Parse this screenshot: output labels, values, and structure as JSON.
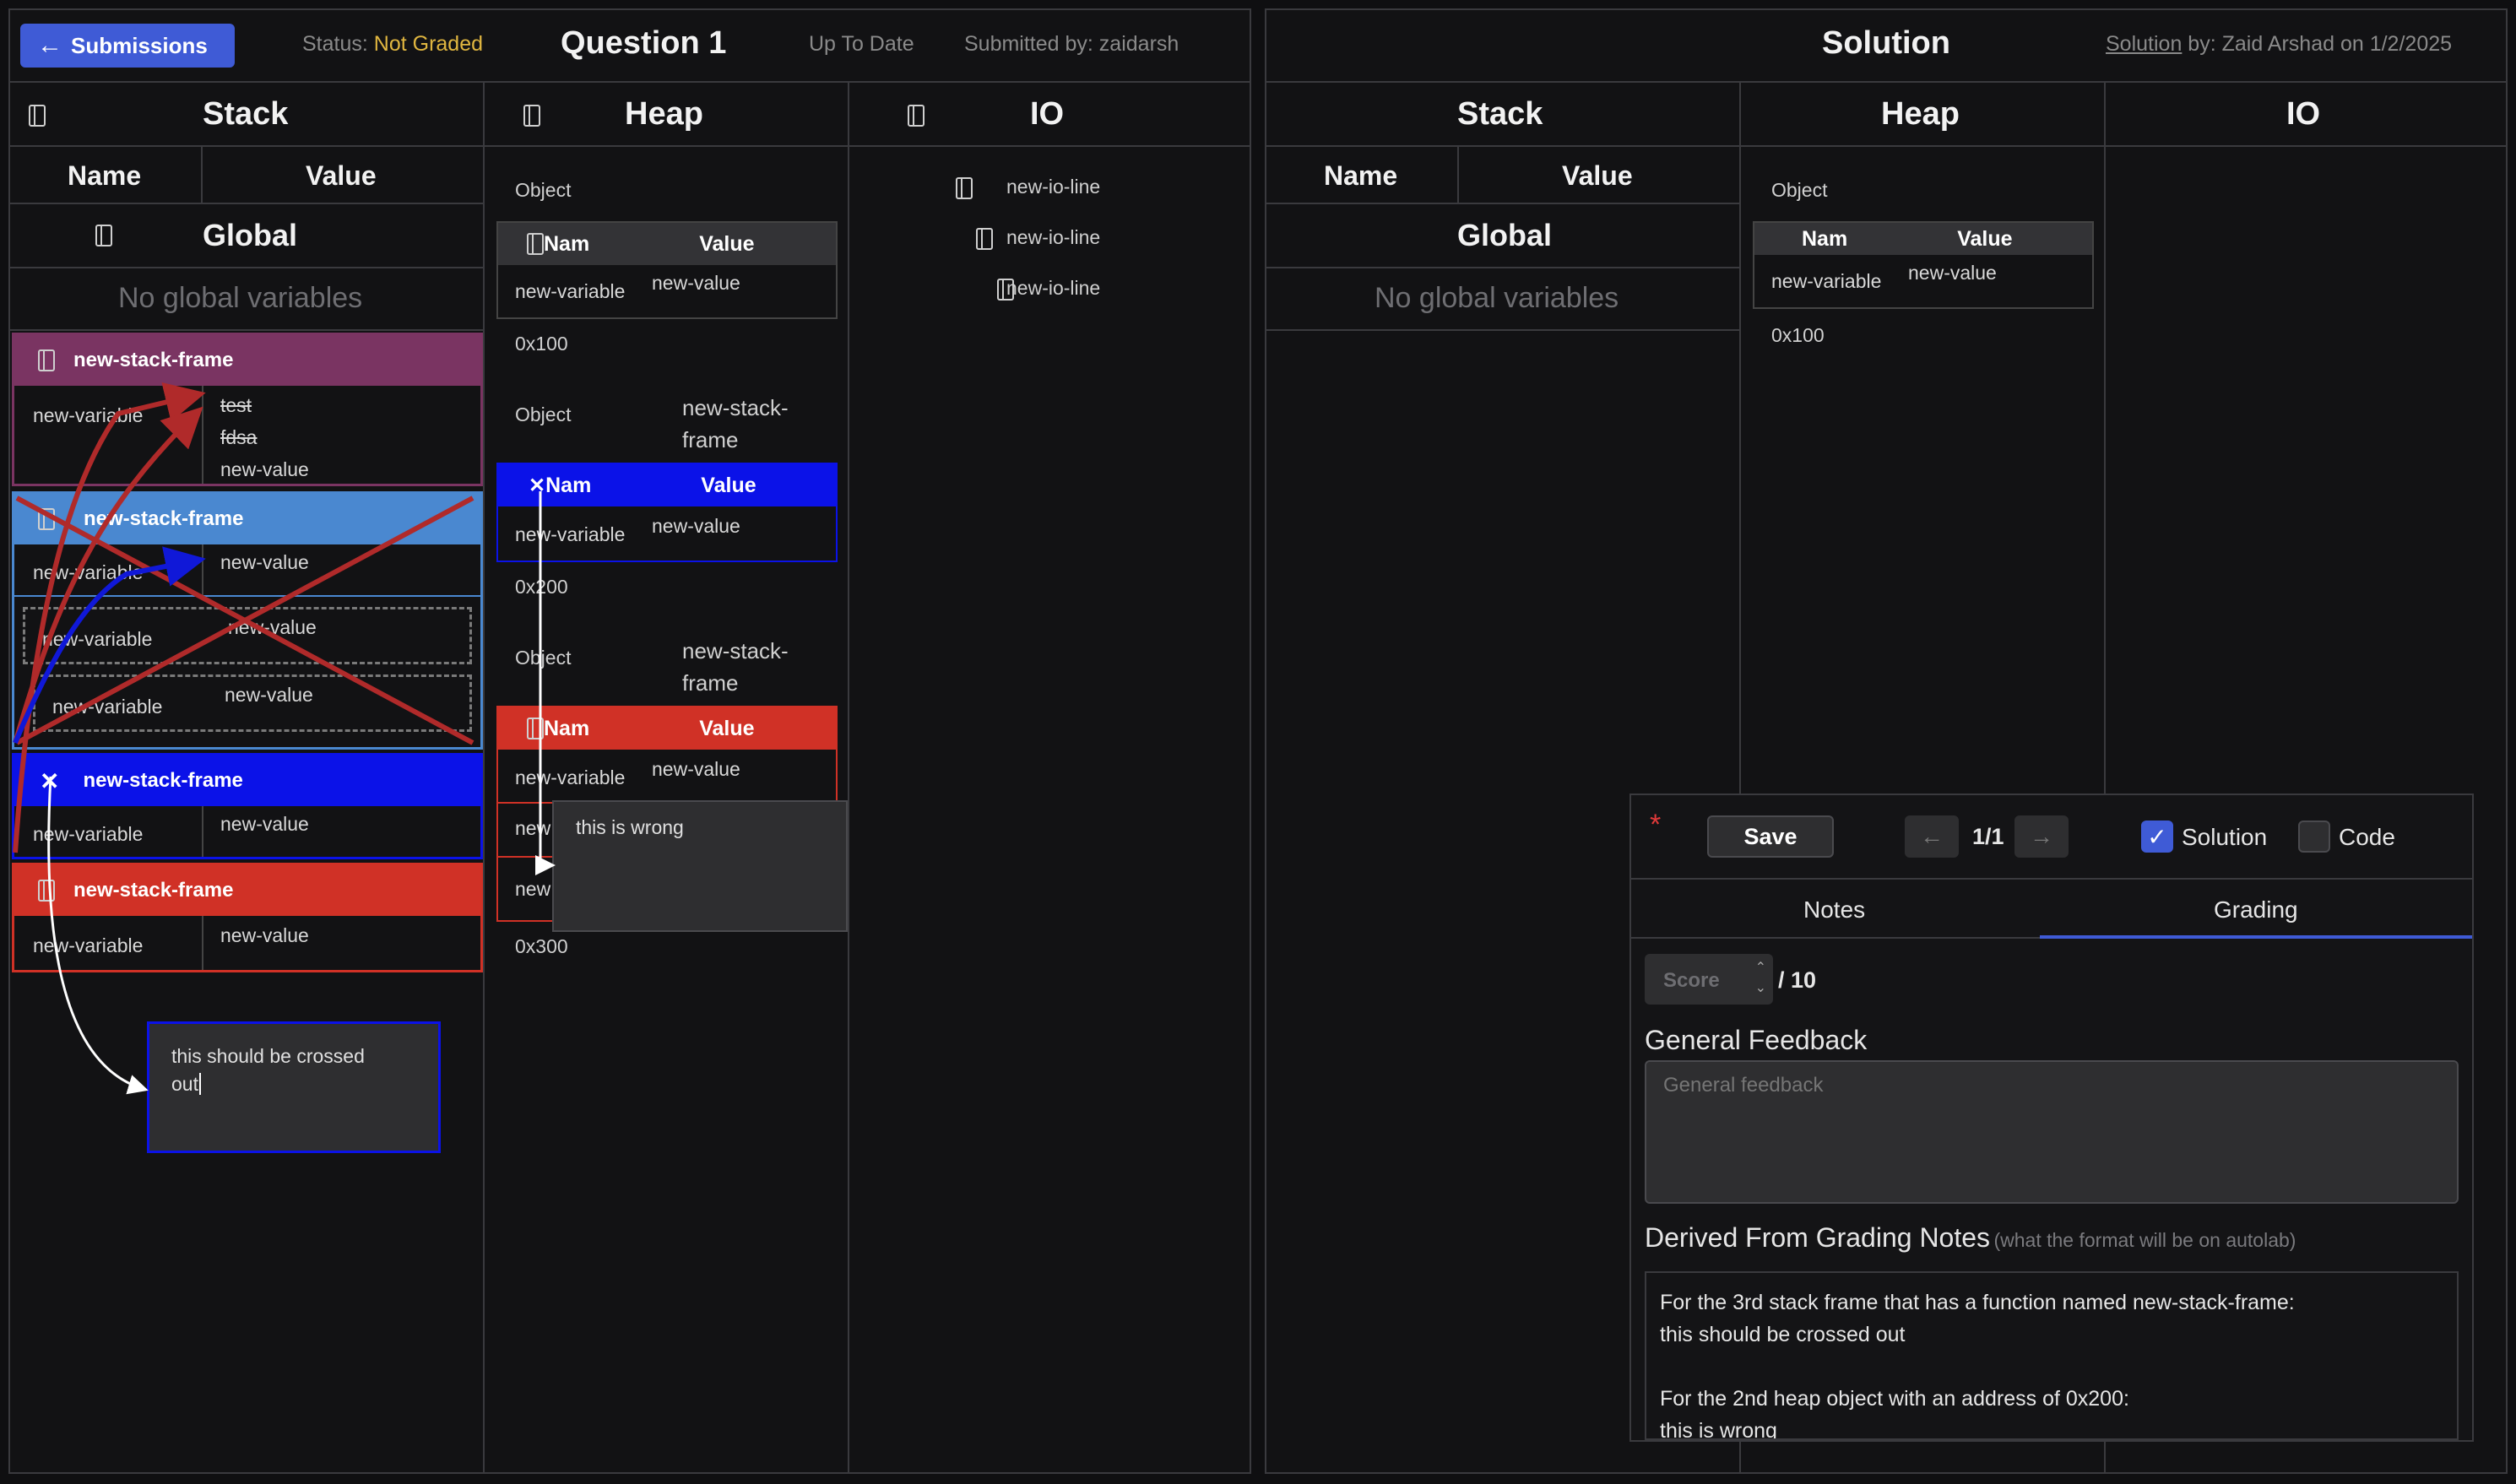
{
  "header": {
    "submissions_label": "Submissions",
    "status_label": "Status:",
    "status_value": "Not Graded",
    "question_title": "Question 1",
    "up_to_date": "Up To Date",
    "submitted_by": "Submitted by: zaidarsh",
    "solution_title": "Solution",
    "solution_link": "Solution",
    "solution_by": " by: Zaid Arshad on 1/2/2025"
  },
  "columns": {
    "stack": "Stack",
    "heap": "Heap",
    "io": "IO",
    "name": "Name",
    "value": "Value",
    "global": "Global",
    "no_globals": "No global variables"
  },
  "stack_frames": [
    {
      "title": "new-stack-frame",
      "var": "new-variable",
      "values": [
        "test",
        "fdsa",
        "new-value"
      ]
    },
    {
      "title": "new-stack-frame",
      "var": "new-variable",
      "value": "new-value",
      "nested1_var": "new-variable",
      "nested1_val": "new-value",
      "nested2_var": "new-variable",
      "nested2_val": "new-value"
    },
    {
      "title": "new-stack-frame",
      "var": "new-variable",
      "value": "new-value"
    },
    {
      "title": "new-stack-frame",
      "var": "new-variable",
      "value": "new-value"
    }
  ],
  "heap": {
    "objects": [
      {
        "label": "Object",
        "name_h": "Nam",
        "value_h": "Value",
        "var": "new-variable",
        "val": "new-value",
        "addr": "0x100"
      },
      {
        "label": "Object",
        "frame_line1": "new-stack-",
        "frame_line2": "frame",
        "name_h": "Nam",
        "value_h": "Value",
        "var": "new-variable",
        "val": "new-value",
        "addr": "0x200"
      },
      {
        "label": "Object",
        "frame_line1": "new-stack-",
        "frame_line2": "frame",
        "name_h": "Nam",
        "value_h": "Value",
        "var": "new-variable",
        "val": "new-value",
        "var2": "new",
        "var3": "new",
        "addr": "0x300"
      }
    ]
  },
  "io_lines": [
    "new-io-line",
    "new-io-line",
    "new-io-line"
  ],
  "notes": {
    "heap_note": "this is wrong",
    "stack_note_line1": "this should be crossed",
    "stack_note_line2": "out"
  },
  "solution_heap": {
    "label": "Object",
    "name_h": "Nam",
    "value_h": "Value",
    "var": "new-variable",
    "val": "new-value",
    "addr": "0x100"
  },
  "grading": {
    "asterisk": "*",
    "save_label": "Save",
    "page": "1/1",
    "solution_checkbox": "Solution",
    "code_checkbox": "Code",
    "tab_notes": "Notes",
    "tab_grading": "Grading",
    "score_placeholder": "Score",
    "score_max": "/ 10",
    "general_feedback_title": "General Feedback",
    "general_feedback_placeholder": "General feedback",
    "derived_title": "Derived From Grading Notes",
    "derived_hint": "(what the format will be on autolab)",
    "derived_lines": [
      "For the 3rd stack frame that has a function named new-stack-frame:",
      "this should be crossed out",
      "",
      "For the 2nd heap object with an address of 0x200:",
      "this is wrong"
    ]
  },
  "colors": {
    "purple": "#7a3462",
    "lightblue": "#4a88d0",
    "blue": "#0b12e8",
    "red": "#d03126",
    "status_yellow": "#e0b640",
    "accent": "#3f5bd6"
  }
}
